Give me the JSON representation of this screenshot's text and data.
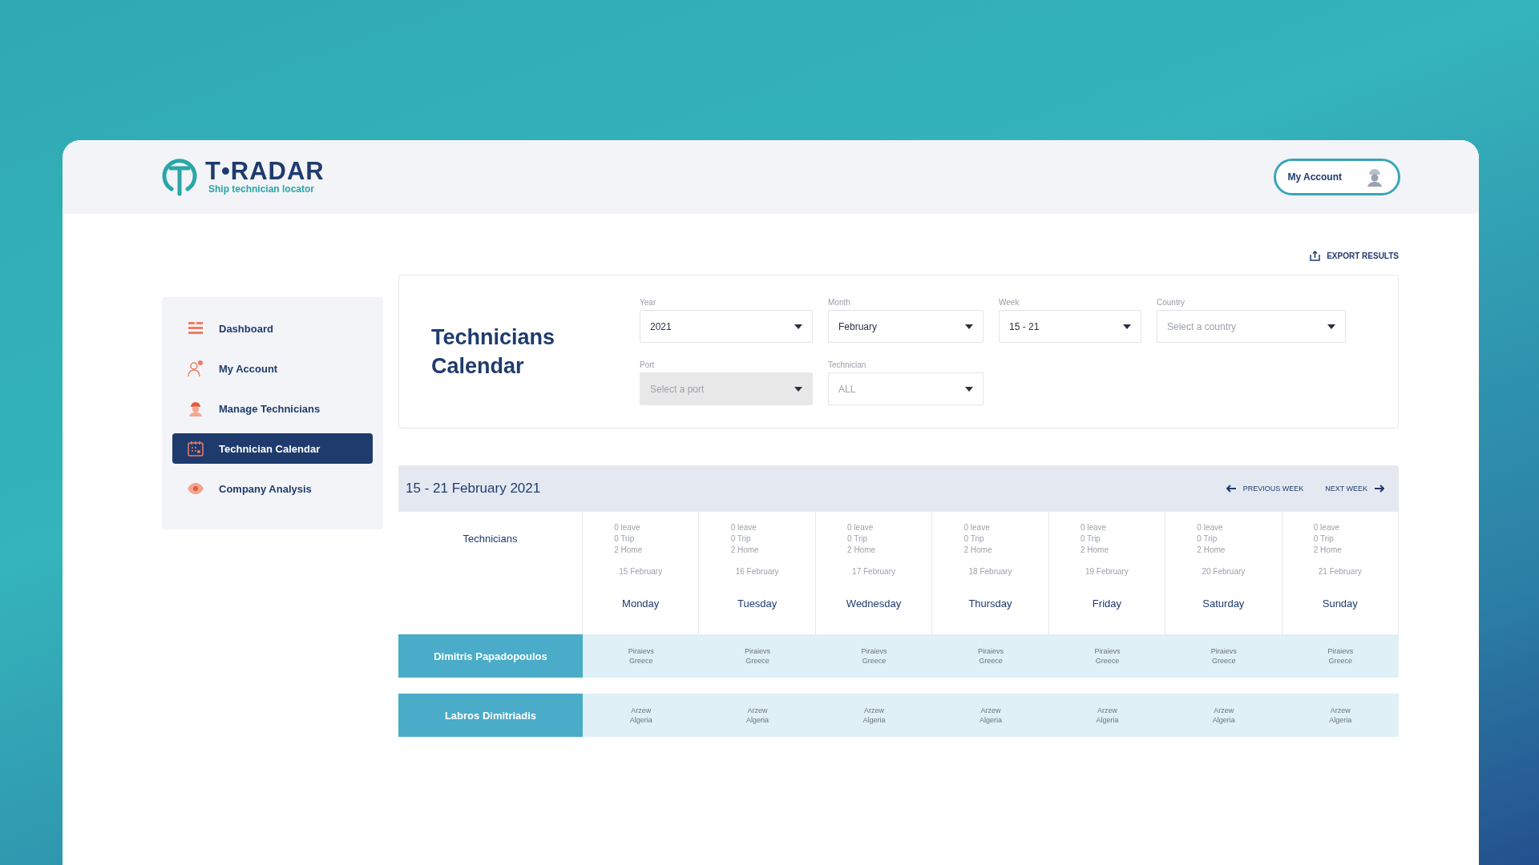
{
  "brand": {
    "title": "T•RADAR",
    "tagline": "Ship technician locator"
  },
  "account_button": {
    "label": "My Account"
  },
  "export_button": {
    "label": "EXPORT RESULTS"
  },
  "sidebar": {
    "items": [
      {
        "label": "Dashboard",
        "kind": "dashboard",
        "selected": false
      },
      {
        "label": "My Account",
        "kind": "account",
        "selected": false
      },
      {
        "label": "Manage Technicians",
        "kind": "technician",
        "selected": false
      },
      {
        "label": "Technician Calendar",
        "kind": "calendar",
        "selected": true
      },
      {
        "label": "Company Analysis",
        "kind": "eye",
        "selected": false
      }
    ]
  },
  "filters": {
    "title": "Technicians Calendar",
    "fields": [
      {
        "label": "Year",
        "value": "2021",
        "disabled": false
      },
      {
        "label": "Month",
        "value": "February",
        "disabled": false
      },
      {
        "label": "Week",
        "value": "15 - 21",
        "disabled": false
      },
      {
        "label": "Country",
        "placeholder": "Select a country",
        "disabled": false
      },
      {
        "label": "Port",
        "placeholder": "Select a port",
        "disabled": true
      },
      {
        "label": "Technician",
        "placeholder": "ALL",
        "disabled": false
      }
    ]
  },
  "calendar": {
    "range": "15 - 21 February 2021",
    "previous": "PREVIOUS WEEK",
    "next": "NEXT WEEK",
    "corner": "Technicians",
    "days": [
      {
        "stats": [
          "0 leave",
          "0 Trip",
          "2 Home"
        ],
        "date": "15 February",
        "weekday": "Monday"
      },
      {
        "stats": [
          "0 leave",
          "0 Trip",
          "2 Home"
        ],
        "date": "16 February",
        "weekday": "Tuesday"
      },
      {
        "stats": [
          "0 leave",
          "0 Trip",
          "2 Home"
        ],
        "date": "17 February",
        "weekday": "Wednesday"
      },
      {
        "stats": [
          "0 leave",
          "0 Trip",
          "2 Home"
        ],
        "date": "18 February",
        "weekday": "Thursday"
      },
      {
        "stats": [
          "0 leave",
          "0 Trip",
          "2 Home"
        ],
        "date": "19 February",
        "weekday": "Friday"
      },
      {
        "stats": [
          "0 leave",
          "0 Trip",
          "2 Home"
        ],
        "date": "20 February",
        "weekday": "Saturday"
      },
      {
        "stats": [
          "0 leave",
          "0 Trip",
          "2 Home"
        ],
        "date": "21 February",
        "weekday": "Sunday"
      }
    ],
    "rows": [
      {
        "name": "Dimitris Papadopoulos",
        "cells": [
          {
            "port": "Piraievs",
            "country": "Greece"
          },
          {
            "port": "Piraievs",
            "country": "Greece"
          },
          {
            "port": "Piraievs",
            "country": "Greece"
          },
          {
            "port": "Piraievs",
            "country": "Greece"
          },
          {
            "port": "Piraievs",
            "country": "Greece"
          },
          {
            "port": "Piraievs",
            "country": "Greece"
          },
          {
            "port": "Piraievs",
            "country": "Greece"
          }
        ]
      },
      {
        "name": "Labros Dimitriadis",
        "cells": [
          {
            "port": "Arzew",
            "country": "Algeria"
          },
          {
            "port": "Arzew",
            "country": "Algeria"
          },
          {
            "port": "Arzew",
            "country": "Algeria"
          },
          {
            "port": "Arzew",
            "country": "Algeria"
          },
          {
            "port": "Arzew",
            "country": "Algeria"
          },
          {
            "port": "Arzew",
            "country": "Algeria"
          },
          {
            "port": "Arzew",
            "country": "Algeria"
          }
        ]
      }
    ]
  }
}
